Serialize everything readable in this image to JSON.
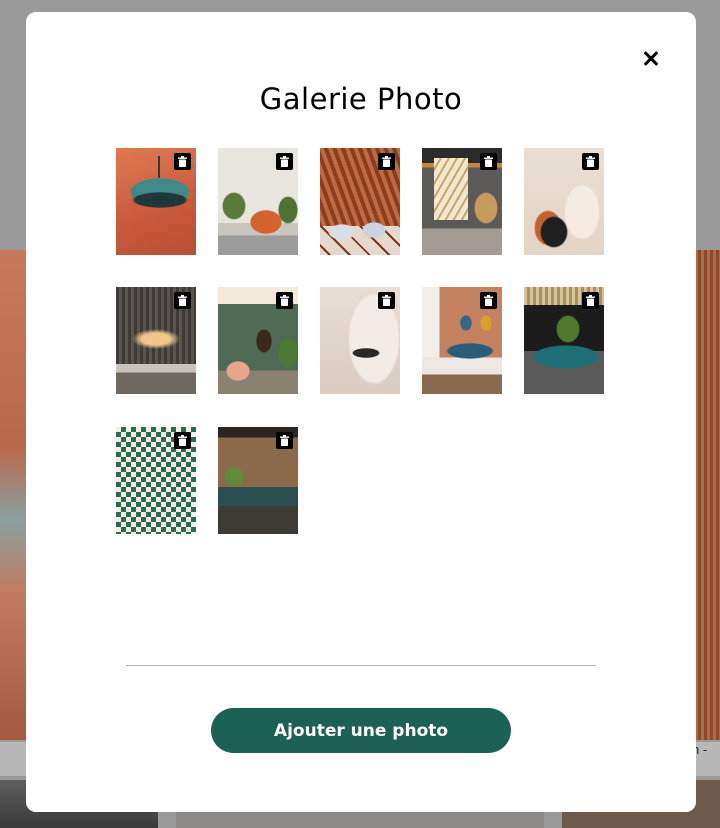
{
  "modal": {
    "title": "Galerie Photo",
    "add_button_label": "Ajouter une photo"
  },
  "background": {
    "caption_right": "n -"
  },
  "photos": [
    {
      "subject": "teal pendant lamp on orange wall"
    },
    {
      "subject": "living room with orange armchair and plants"
    },
    {
      "subject": "restaurant under glass roof with terrazzo floor"
    },
    {
      "subject": "room with hanging rattan chair and screen"
    },
    {
      "subject": "arched shapes decor on beige wall"
    },
    {
      "subject": "minimal kitchen with slatted wall and lighting"
    },
    {
      "subject": "green lounge with pink armchair and art"
    },
    {
      "subject": "white arched room with bench"
    },
    {
      "subject": "bedroom with teal headboard and paintings"
    },
    {
      "subject": "bar with teal counter and stools"
    },
    {
      "subject": "restaurant corridor with checkered floor"
    },
    {
      "subject": "café facade with dark green bar"
    }
  ],
  "colors": {
    "accent": "#1d6154",
    "trash_bg": "#000000"
  }
}
